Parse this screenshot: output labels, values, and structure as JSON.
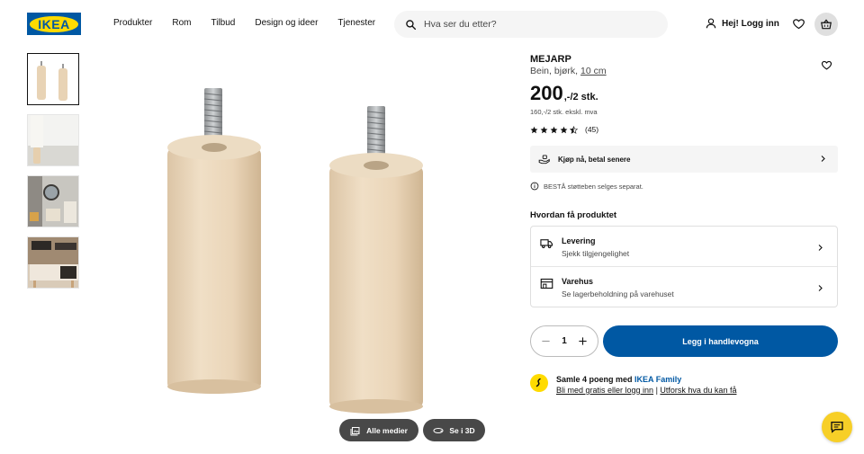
{
  "header": {
    "logo_text": "IKEA",
    "nav": [
      "Produkter",
      "Rom",
      "Tilbud",
      "Design og ideer",
      "Tjenester"
    ],
    "search_placeholder": "Hva ser du etter?",
    "login_label": "Hej! Logg inn"
  },
  "thumbnails": [
    "legs",
    "wall",
    "hallway",
    "livingroom"
  ],
  "media_buttons": {
    "all_media": "Alle medier",
    "view_3d": "Se i 3D"
  },
  "product": {
    "name": "MEJARP",
    "desc_prefix": "Bein, bjørk, ",
    "desc_size": "10 cm",
    "price": "200",
    "price_suffix": ",-/2 stk.",
    "price_ex_vat": "160,-/2 stk. ekskl. mva",
    "rating_value": 4.5,
    "review_count": "(45)",
    "paylater": "Kjøp nå, betal senere",
    "note": "BESTÅ støtteben selges separat."
  },
  "how_to_get": {
    "title": "Hvordan få produktet",
    "delivery_title": "Levering",
    "delivery_sub": "Sjekk tilgjengelighet",
    "store_title": "Varehus",
    "store_sub": "Se lagerbeholdning på varehuset"
  },
  "purchase": {
    "quantity": "1",
    "add_to_cart": "Legg i handlevogna"
  },
  "family": {
    "line1_prefix": "Samle 4 poeng med ",
    "line1_brand": "IKEA Family",
    "link1": "Bli med gratis eller logg inn",
    "separator": " | ",
    "link2": "Utforsk hva du kan få"
  },
  "colors": {
    "brand_blue": "#0058a3",
    "brand_yellow": "#ffdb00",
    "chat_yellow": "#f7cf27"
  }
}
